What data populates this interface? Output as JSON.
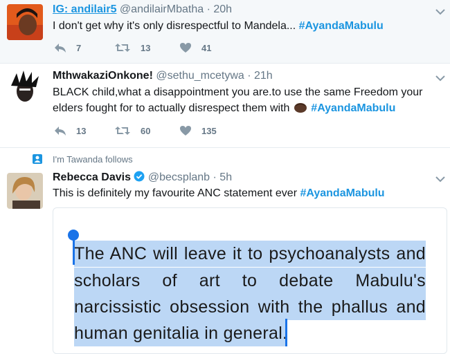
{
  "tweets": [
    {
      "name": "IG: andilair5",
      "handle": "@andilairMbatha",
      "dot": "·",
      "time": "20h",
      "text": "I don't get why it's only disrespectful to Mandela...",
      "hashtag": "#AyandaMabulu",
      "replies": "7",
      "retweets": "13",
      "likes": "41"
    },
    {
      "name": "MthwakaziOnkone!",
      "handle": "@sethu_mcetywa",
      "dot": "·",
      "time": "21h",
      "text_line1": "BLACK child,what a disappointment you are.to use the same Freedom your",
      "text_line2": "elders fought for to actually disrespect them with",
      "hashtag": "#AyandaMabulu",
      "replies": "13",
      "retweets": "60",
      "likes": "135"
    },
    {
      "context": "I'm Tawanda follows",
      "name": "Rebecca Davis",
      "handle": "@becsplanb",
      "dot": "·",
      "time": "5h",
      "text": "This is definitely my favourite ANC statement ever",
      "hashtag": "#AyandaMabulu",
      "quote_lines": [
        "The ANC will leave it to psychoanalysts and",
        "scholars of art to debate Mabulu's",
        "narcissistic obsession with the phallus and",
        "human genitalia in general."
      ]
    }
  ],
  "colors": {
    "accent": "#1b95e0",
    "selection": "#bcd7f5",
    "muted": "#657786"
  },
  "icons": [
    "reply-icon",
    "retweet-icon",
    "like-icon",
    "chevron-down-icon",
    "verified-icon",
    "person-icon"
  ]
}
